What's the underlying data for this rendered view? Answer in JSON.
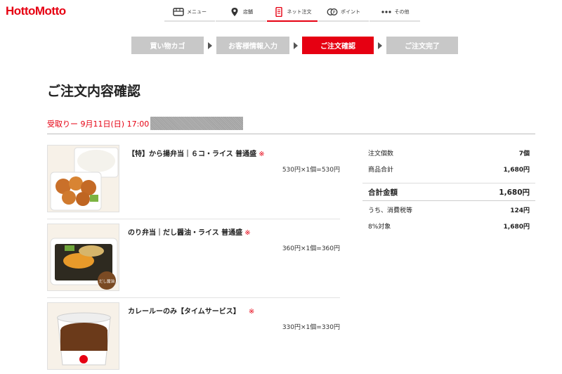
{
  "brand": {
    "logo_text": "HottoMotto",
    "color": "#e60012"
  },
  "nav": {
    "items": [
      {
        "label": "メニュー",
        "icon": "menu-box-icon",
        "active": false
      },
      {
        "label": "店舗",
        "icon": "location-pin-icon",
        "active": false
      },
      {
        "label": "ネット注文",
        "icon": "mobile-order-icon",
        "active": true
      },
      {
        "label": "ポイント",
        "icon": "points-icon",
        "active": false
      },
      {
        "label": "その他",
        "icon": "more-dots-icon",
        "active": false
      }
    ]
  },
  "steps": [
    {
      "label": "買い物カゴ",
      "active": false
    },
    {
      "label": "お客様情報入力",
      "active": false
    },
    {
      "label": "ご注文確認",
      "active": true
    },
    {
      "label": "ご注文完了",
      "active": false
    }
  ],
  "page_title": "ご注文内容確認",
  "pickup": {
    "label": "受取りー 9月11日(日) 17:00"
  },
  "items": [
    {
      "name": "【特】から揚弁当｜６コ・ライス 普通盛",
      "mark": "※",
      "price": "530円×1個=530円",
      "image": "karaage-bento-photo"
    },
    {
      "name": "のり弁当｜だし醤油・ライス 普通盛",
      "mark": "※",
      "price": "360円×1個=360円",
      "image": "nori-bento-photo",
      "badge": "だし醤油"
    },
    {
      "name": "カレールーのみ【タイムサービス】",
      "mark": "※",
      "price": "330円×1個=330円",
      "image": "curry-roux-photo"
    }
  ],
  "summary": {
    "count_label": "注文個数",
    "count_value": "7個",
    "subtotal_label": "商品合計",
    "subtotal_value": "1,680円",
    "total_label": "合計金額",
    "total_value": "1,680円",
    "tax_label": "うち、消費税等",
    "tax_value": "124円",
    "rate_label": "8%対象",
    "rate_value": "1,680円"
  }
}
